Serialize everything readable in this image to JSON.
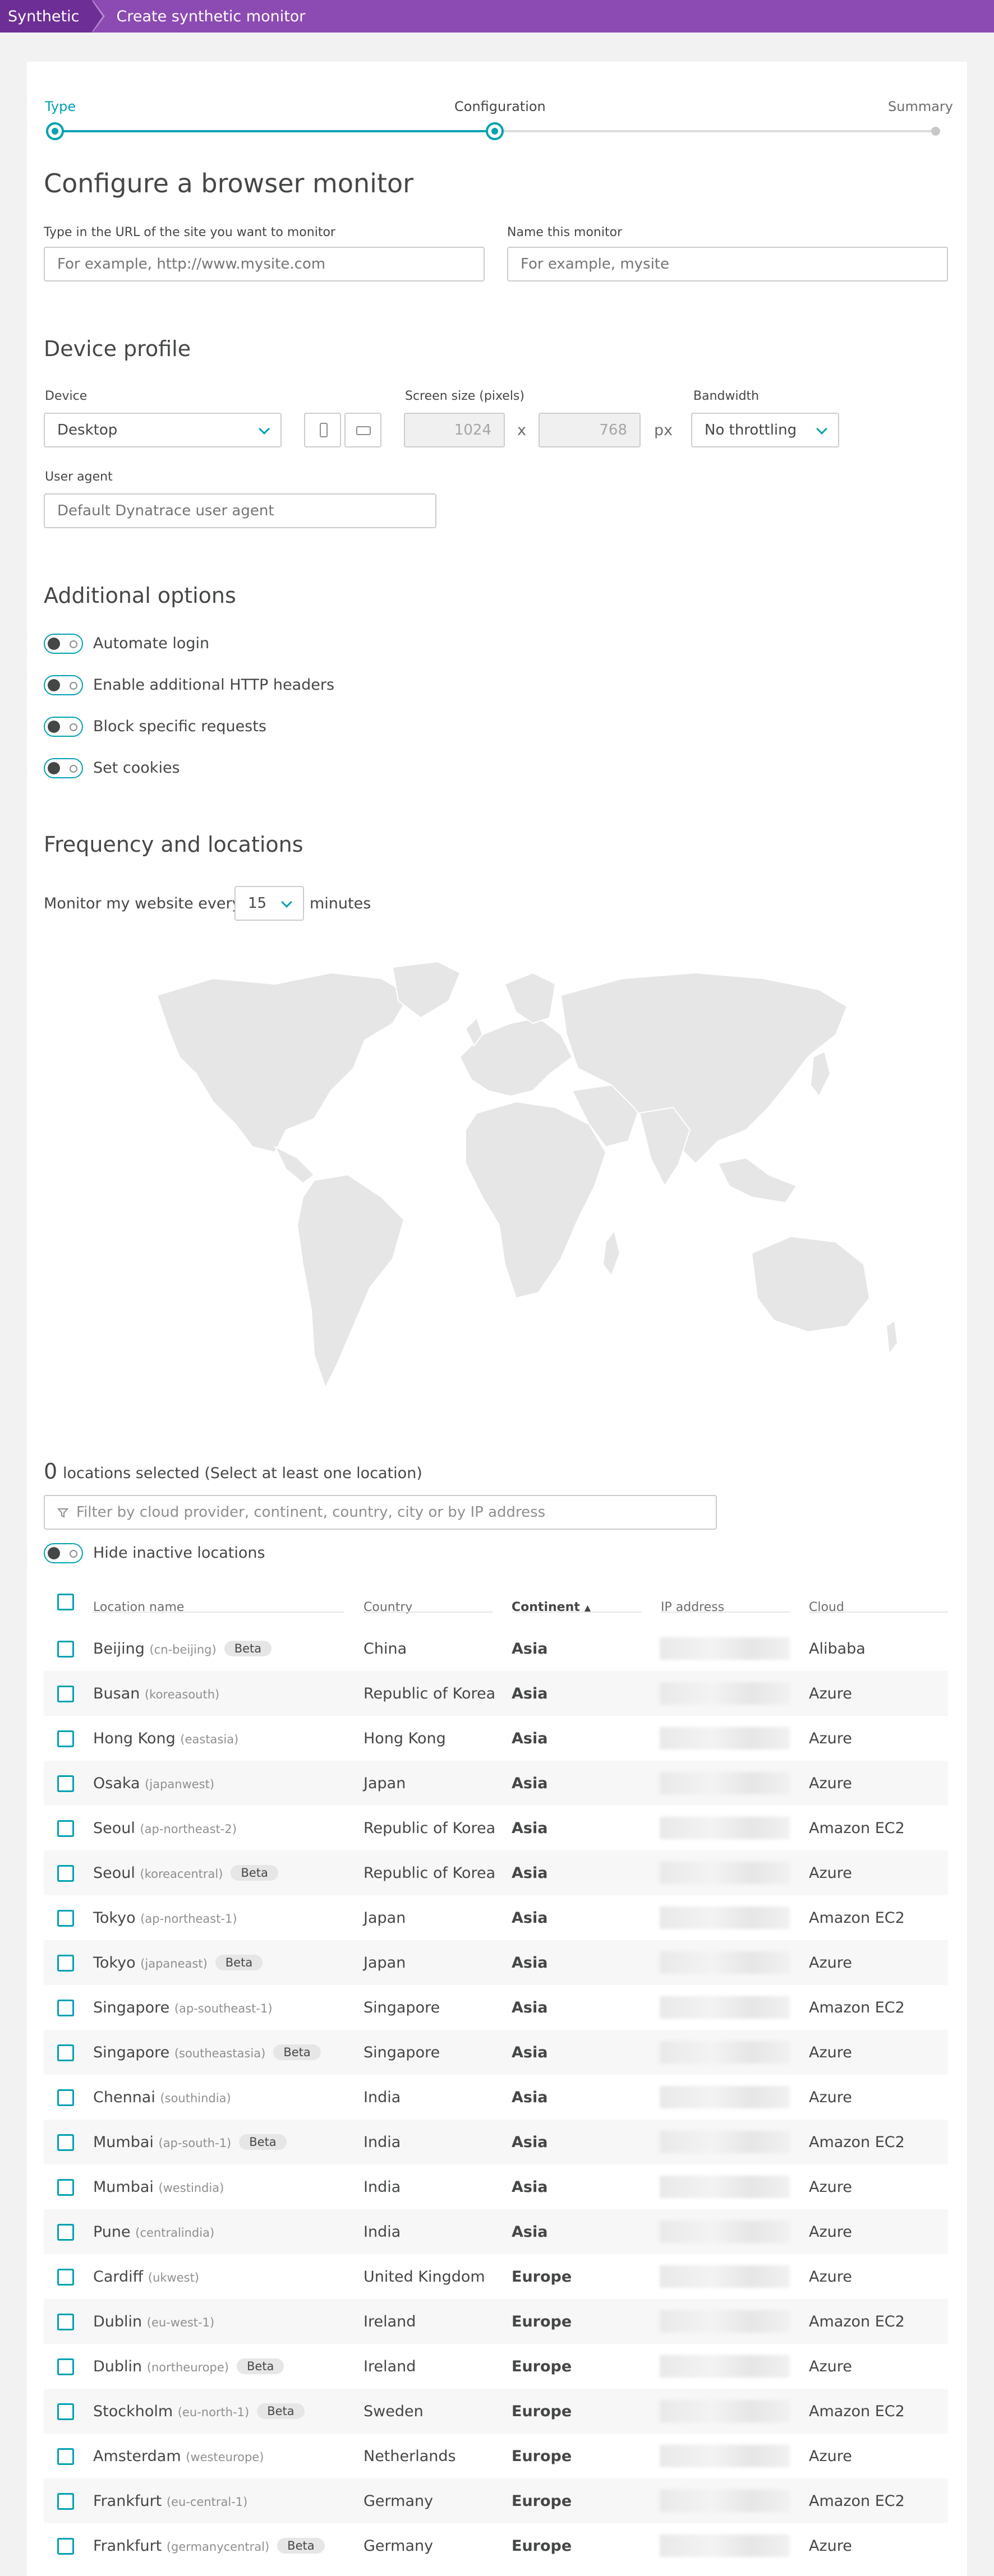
{
  "breadcrumb": {
    "root": "Synthetic",
    "page": "Create synthetic monitor"
  },
  "stepper": {
    "steps": [
      "Type",
      "Configuration",
      "Summary"
    ],
    "active_index": 1
  },
  "configure": {
    "title": "Configure a browser monitor",
    "url_label": "Type in the URL of the site you want to monitor",
    "url_placeholder": "For example, http://www.mysite.com",
    "name_label": "Name this monitor",
    "name_placeholder": "For example, mysite"
  },
  "device_profile": {
    "title": "Device profile",
    "device_label": "Device",
    "device_value": "Desktop",
    "screen_label": "Screen size (pixels)",
    "width": "1024",
    "height": "768",
    "times": "x",
    "unit": "px",
    "bandwidth_label": "Bandwidth",
    "bandwidth_value": "No throttling",
    "user_agent_label": "User agent",
    "user_agent_placeholder": "Default Dynatrace user agent"
  },
  "additional_options": {
    "title": "Additional options",
    "items": [
      "Automate login",
      "Enable additional HTTP headers",
      "Block specific requests",
      "Set cookies"
    ]
  },
  "frequency": {
    "title": "Frequency and locations",
    "prefix": "Monitor my website every",
    "value": "15",
    "suffix": "minutes"
  },
  "locations": {
    "selected_count": "0",
    "selected_text": "locations selected (Select at least one location)",
    "filter_placeholder": "Filter by cloud provider, continent, country, city or by IP address",
    "hide_inactive": "Hide inactive locations",
    "columns": {
      "name": "Location name",
      "country": "Country",
      "continent": "Continent",
      "ip": "IP address",
      "cloud": "Cloud"
    },
    "sort_indicator": "▲",
    "beta_label": "Beta",
    "rows": [
      {
        "city": "Beijing",
        "code": "(cn-beijing)",
        "beta": true,
        "country": "China",
        "continent": "Asia",
        "cloud": "Alibaba"
      },
      {
        "city": "Busan",
        "code": "(koreasouth)",
        "beta": false,
        "country": "Republic of Korea",
        "continent": "Asia",
        "cloud": "Azure"
      },
      {
        "city": "Hong Kong",
        "code": "(eastasia)",
        "beta": false,
        "country": "Hong Kong",
        "continent": "Asia",
        "cloud": "Azure"
      },
      {
        "city": "Osaka",
        "code": "(japanwest)",
        "beta": false,
        "country": "Japan",
        "continent": "Asia",
        "cloud": "Azure"
      },
      {
        "city": "Seoul",
        "code": "(ap-northeast-2)",
        "beta": false,
        "country": "Republic of Korea",
        "continent": "Asia",
        "cloud": "Amazon EC2"
      },
      {
        "city": "Seoul",
        "code": "(koreacentral)",
        "beta": true,
        "country": "Republic of Korea",
        "continent": "Asia",
        "cloud": "Azure"
      },
      {
        "city": "Tokyo",
        "code": "(ap-northeast-1)",
        "beta": false,
        "country": "Japan",
        "continent": "Asia",
        "cloud": "Amazon EC2"
      },
      {
        "city": "Tokyo",
        "code": "(japaneast)",
        "beta": true,
        "country": "Japan",
        "continent": "Asia",
        "cloud": "Azure"
      },
      {
        "city": "Singapore",
        "code": "(ap-southeast-1)",
        "beta": false,
        "country": "Singapore",
        "continent": "Asia",
        "cloud": "Amazon EC2"
      },
      {
        "city": "Singapore",
        "code": "(southeastasia)",
        "beta": true,
        "country": "Singapore",
        "continent": "Asia",
        "cloud": "Azure"
      },
      {
        "city": "Chennai",
        "code": "(southindia)",
        "beta": false,
        "country": "India",
        "continent": "Asia",
        "cloud": "Azure"
      },
      {
        "city": "Mumbai",
        "code": "(ap-south-1)",
        "beta": true,
        "country": "India",
        "continent": "Asia",
        "cloud": "Amazon EC2"
      },
      {
        "city": "Mumbai",
        "code": "(westindia)",
        "beta": false,
        "country": "India",
        "continent": "Asia",
        "cloud": "Azure"
      },
      {
        "city": "Pune",
        "code": "(centralindia)",
        "beta": false,
        "country": "India",
        "continent": "Asia",
        "cloud": "Azure"
      },
      {
        "city": "Cardiff",
        "code": "(ukwest)",
        "beta": false,
        "country": "United Kingdom",
        "continent": "Europe",
        "cloud": "Azure"
      },
      {
        "city": "Dublin",
        "code": "(eu-west-1)",
        "beta": false,
        "country": "Ireland",
        "continent": "Europe",
        "cloud": "Amazon EC2"
      },
      {
        "city": "Dublin",
        "code": "(northeurope)",
        "beta": true,
        "country": "Ireland",
        "continent": "Europe",
        "cloud": "Azure"
      },
      {
        "city": "Stockholm",
        "code": "(eu-north-1)",
        "beta": true,
        "country": "Sweden",
        "continent": "Europe",
        "cloud": "Amazon EC2"
      },
      {
        "city": "Amsterdam",
        "code": "(westeurope)",
        "beta": false,
        "country": "Netherlands",
        "continent": "Europe",
        "cloud": "Azure"
      },
      {
        "city": "Frankfurt",
        "code": "(eu-central-1)",
        "beta": false,
        "country": "Germany",
        "continent": "Europe",
        "cloud": "Amazon EC2"
      },
      {
        "city": "Frankfurt",
        "code": "(germanycentral)",
        "beta": true,
        "country": "Germany",
        "continent": "Europe",
        "cloud": "Azure"
      }
    ]
  },
  "colors": {
    "accent": "#00a1b2",
    "brand": "#6d2f96",
    "header": "#8c4bb3"
  }
}
